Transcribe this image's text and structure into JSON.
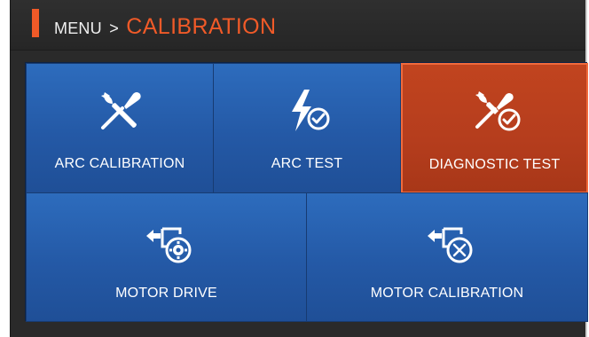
{
  "header": {
    "breadcrumb": "MENU",
    "separator": ">",
    "title": "CALIBRATION"
  },
  "tiles": [
    {
      "label": "ARC CALIBRATION",
      "icon": "wrench-screwdriver-icon",
      "active": false
    },
    {
      "label": "ARC TEST",
      "icon": "lightning-check-icon",
      "active": false
    },
    {
      "label": "DIAGNOSTIC TEST",
      "icon": "tools-check-icon",
      "active": true
    },
    {
      "label": "MOTOR DRIVE",
      "icon": "motor-gear-icon",
      "active": false
    },
    {
      "label": "MOTOR CALIBRATION",
      "icon": "motor-tools-icon",
      "active": false
    }
  ],
  "colors": {
    "accent": "#f05a28",
    "tile_blue": "#2459a6",
    "tile_active": "#b53d1d",
    "background": "#2a2a2a"
  }
}
